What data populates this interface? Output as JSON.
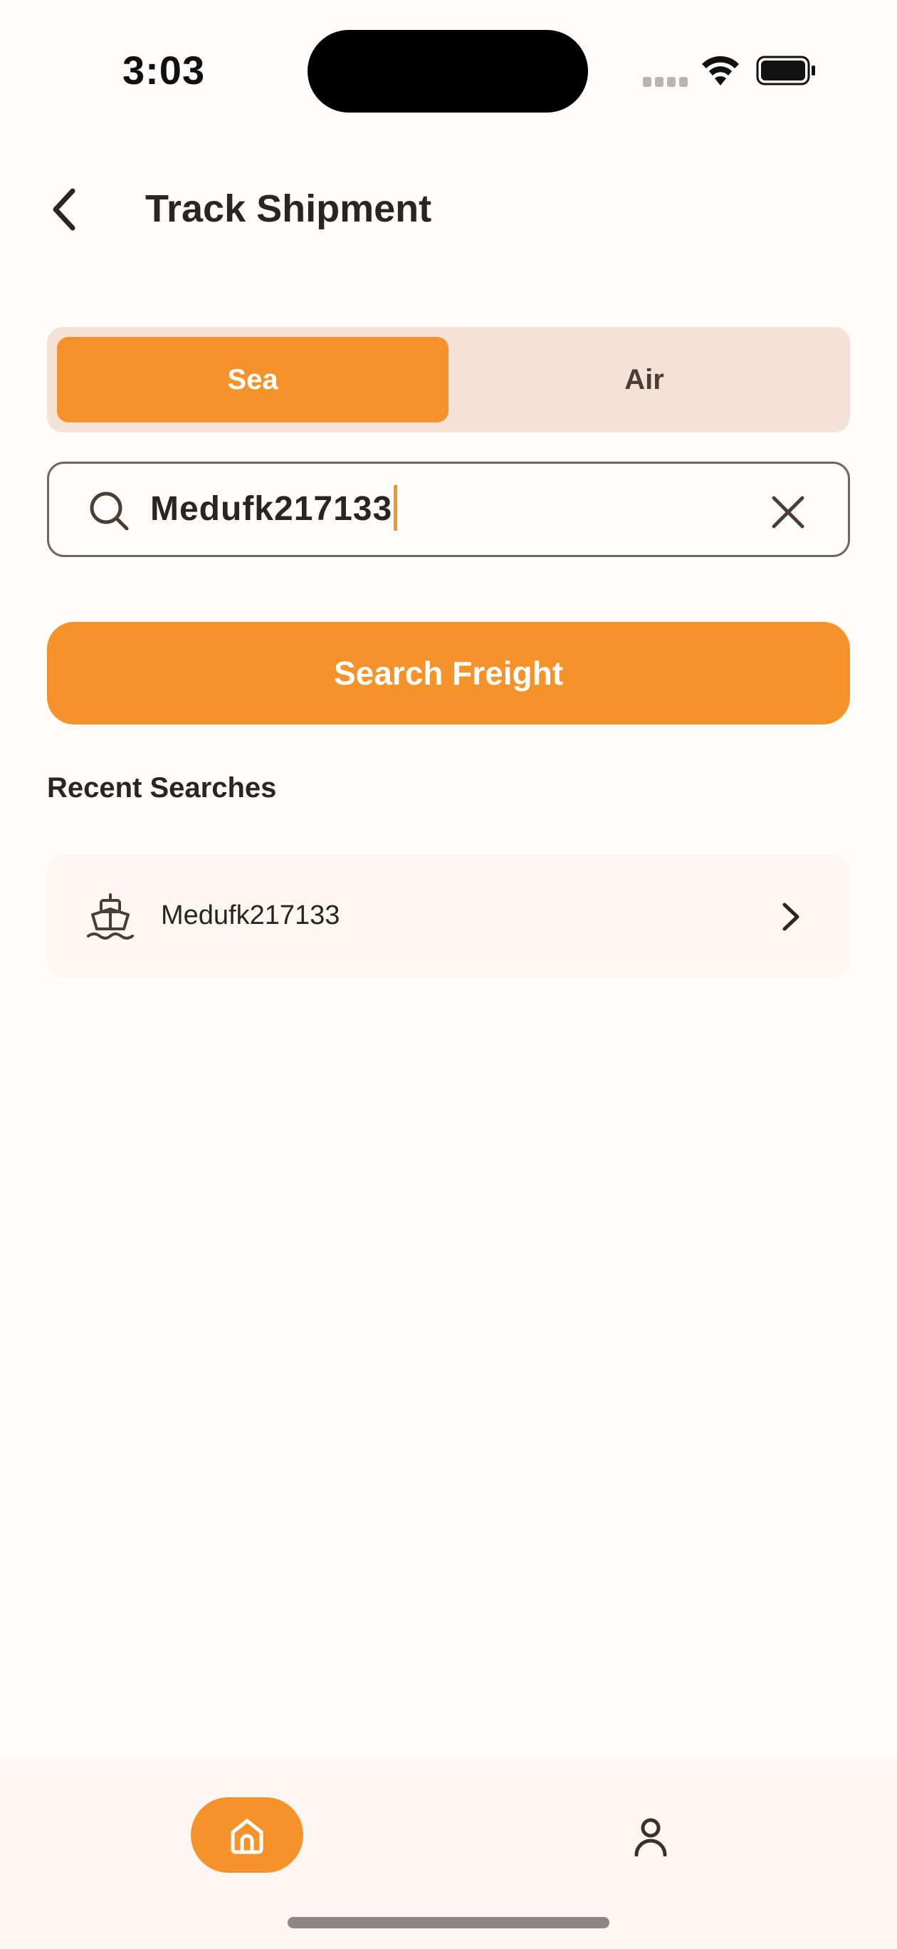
{
  "status_bar": {
    "time": "3:03"
  },
  "header": {
    "title": "Track Shipment",
    "back_icon": "chevron-left-icon"
  },
  "segment": {
    "options": [
      {
        "label": "Sea",
        "selected": true
      },
      {
        "label": "Air",
        "selected": false
      }
    ]
  },
  "search": {
    "value": "Medufk217133",
    "icon": "search-icon",
    "clear_icon": "close-icon"
  },
  "search_button": {
    "label": "Search Freight"
  },
  "recent": {
    "title": "Recent Searches",
    "items": [
      {
        "label": "Medufk217133",
        "icon": "ship-icon"
      }
    ]
  },
  "bottom_nav": {
    "items": [
      {
        "name": "home",
        "icon": "home-icon",
        "active": true
      },
      {
        "name": "profile",
        "icon": "user-icon",
        "active": false
      }
    ]
  },
  "colors": {
    "accent": "#f5932a",
    "segment_bg": "#f5e2d6",
    "text": "#2b2521"
  }
}
